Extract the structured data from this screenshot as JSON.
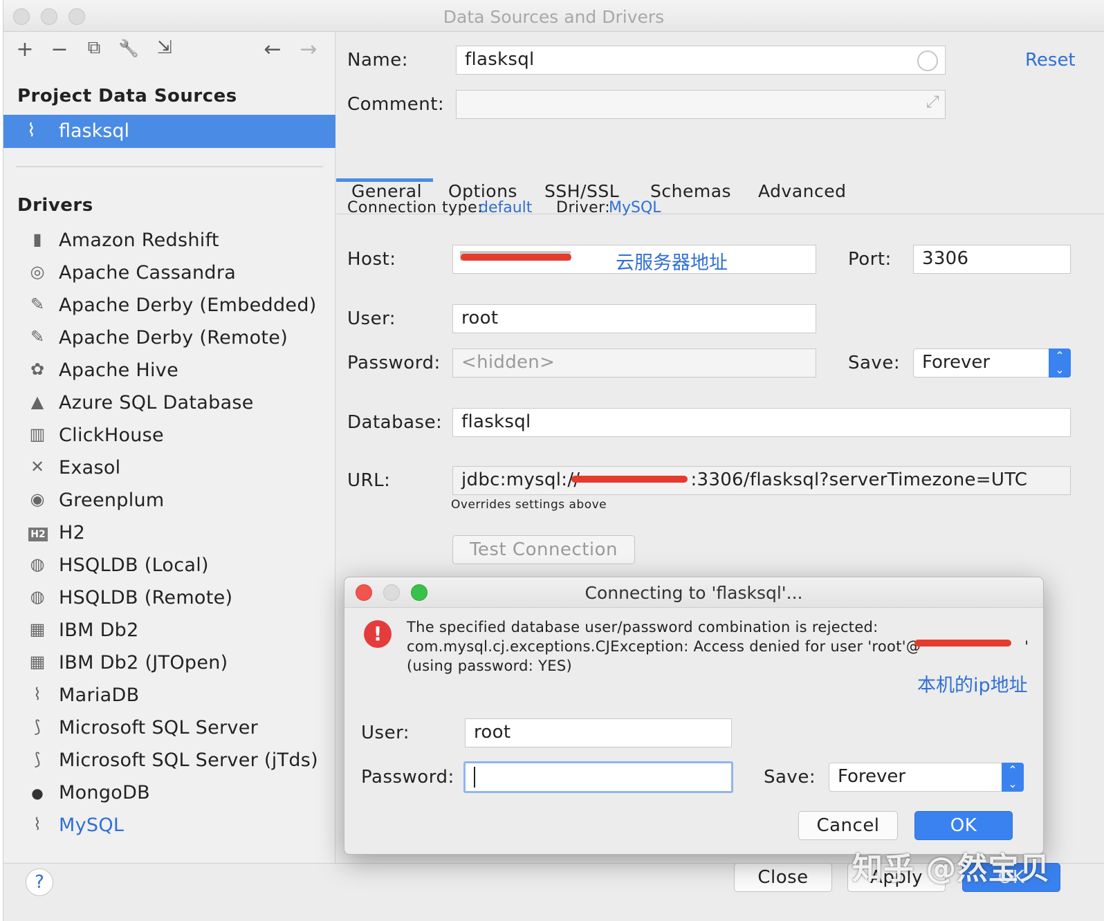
{
  "window": {
    "title": "Data Sources and Drivers"
  },
  "toolbar": {
    "add": "+",
    "remove": "−",
    "duplicate": "⧉",
    "properties": "🔧",
    "import": "⇲",
    "back": "←",
    "forward": "→"
  },
  "sidebar": {
    "project_title": "Project Data Sources",
    "data_sources": [
      {
        "label": "flasksql",
        "icon": "mysql-dolphin-icon"
      }
    ],
    "drivers_title": "Drivers",
    "drivers": [
      {
        "label": "Amazon Redshift",
        "glyph": "▮"
      },
      {
        "label": "Apache Cassandra",
        "glyph": "◎"
      },
      {
        "label": "Apache Derby (Embedded)",
        "glyph": "✎"
      },
      {
        "label": "Apache Derby (Remote)",
        "glyph": "✎"
      },
      {
        "label": "Apache Hive",
        "glyph": "✿"
      },
      {
        "label": "Azure SQL Database",
        "glyph": "▲"
      },
      {
        "label": "ClickHouse",
        "glyph": "▥"
      },
      {
        "label": "Exasol",
        "glyph": "✕"
      },
      {
        "label": "Greenplum",
        "glyph": "◉"
      },
      {
        "label": "H2",
        "glyph": "H2"
      },
      {
        "label": "HSQLDB (Local)",
        "glyph": "◍"
      },
      {
        "label": "HSQLDB (Remote)",
        "glyph": "◍"
      },
      {
        "label": "IBM Db2",
        "glyph": "▦"
      },
      {
        "label": "IBM Db2 (JTOpen)",
        "glyph": "▦"
      },
      {
        "label": "MariaDB",
        "glyph": "⌇"
      },
      {
        "label": "Microsoft SQL Server",
        "glyph": "⟆"
      },
      {
        "label": "Microsoft SQL Server (jTds)",
        "glyph": "⟆"
      },
      {
        "label": "MongoDB",
        "glyph": "●"
      },
      {
        "label": "MySQL",
        "glyph": "⌇"
      }
    ]
  },
  "form": {
    "name_label": "Name:",
    "name_value": "flasksql",
    "comment_label": "Comment:",
    "comment_value": "",
    "reset": "Reset",
    "tabs": [
      "General",
      "Options",
      "SSH/SSL",
      "Schemas",
      "Advanced"
    ],
    "connection_type_label": "Connection type:",
    "connection_type_value": "default",
    "driver_label": "Driver:",
    "driver_value": "MySQL",
    "host_label": "Host:",
    "host_annotation": "云服务器地址",
    "port_label": "Port:",
    "port_value": "3306",
    "user_label": "User:",
    "user_value": "root",
    "password_label": "Password:",
    "password_placeholder": "<hidden>",
    "save_label": "Save:",
    "save_value": "Forever",
    "database_label": "Database:",
    "database_value": "flasksql",
    "url_label": "URL:",
    "url_prefix": "jdbc:mysql://",
    "url_suffix": ":3306/flasksql?serverTimezone=UTC",
    "url_hint": "Overrides settings above",
    "test_connection": "Test Connection"
  },
  "dialog": {
    "title": "Connecting to 'flasksql'...",
    "error_line1": "The specified database user/password combination is rejected:",
    "error_line2": "com.mysql.cj.exceptions.CJException: Access denied for user 'root'@'",
    "error_line2_end": "'",
    "error_line3": "(using password: YES)",
    "annotation": "本机的ip地址",
    "user_label": "User:",
    "user_value": "root",
    "password_label": "Password:",
    "password_value": "",
    "save_label": "Save:",
    "save_value": "Forever",
    "cancel": "Cancel",
    "ok": "OK"
  },
  "footer": {
    "help": "?",
    "close": "Close",
    "apply": "Apply",
    "ok": "OK"
  },
  "watermark": "知乎 @然宝贝",
  "colors": {
    "accent": "#4a8be6",
    "link": "#2f6fd6",
    "error": "#e53b3b",
    "redaction": "#e53b2c"
  }
}
